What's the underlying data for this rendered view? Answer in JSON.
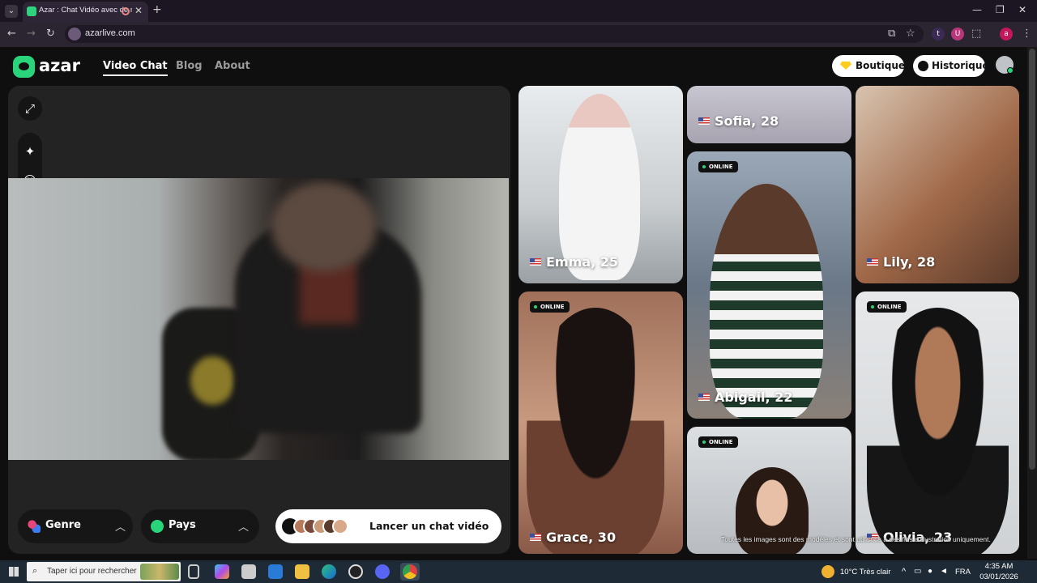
{
  "browser": {
    "tab_title": "Azar : Chat Vidéo avec de n",
    "url": "azarlive.com",
    "ext_t": "t",
    "ext_u": "U",
    "ext_a": "a"
  },
  "header": {
    "logo": "azar",
    "nav": [
      "Video Chat",
      "Blog",
      "About"
    ],
    "boutique": "Boutique",
    "historique": "Historique"
  },
  "controls": {
    "genre": "Genre",
    "pays": "Pays",
    "cta": "Lancer un chat vidéo"
  },
  "profiles": [
    {
      "name": "Emma, 25",
      "online": false
    },
    {
      "name": "Sofia, 28",
      "online": false
    },
    {
      "name": "Lily, 28",
      "online": false
    },
    {
      "name": "Abigail, 22",
      "online": true
    },
    {
      "name": "Grace, 30",
      "online": true
    },
    {
      "name": "Olivia, 23",
      "online": true
    },
    {
      "name": "",
      "online": true
    }
  ],
  "online_label": "ONLINE",
  "disclaimer": "Toutes les images sont des modèles et sont utilisées à des fins d'illustration uniquement.",
  "taskbar": {
    "search_placeholder": "Taper ici pour rechercher",
    "weather": "10°C  Très clair",
    "lang": "FRA",
    "time": "4:35 AM",
    "date": "03/01/2026"
  },
  "colors": {
    "accent": "#2ad47a",
    "panel": "#232323",
    "background": "#0f0f0f"
  }
}
